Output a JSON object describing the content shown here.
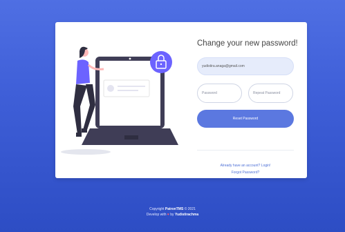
{
  "form": {
    "title": "Change your new password!",
    "email_value": "yudistira.anaga@gmail.com",
    "password_placeholder": "Password",
    "repeat_password_placeholder": "Repeat Password",
    "reset_button_label": "Reset Password",
    "login_link": "Already have an account? Login!",
    "forgot_link": "Forgot Password?"
  },
  "footer": {
    "copyright_prefix": "Copyright",
    "brand": "PatronTMS",
    "copyright_suffix": "© 2021",
    "develop_prefix": "Develop with",
    "heart": "♥",
    "develop_by": "by",
    "author": "Yudistirachma"
  },
  "colors": {
    "accent": "#5b78e0",
    "background": "#3f5fd8",
    "illustration_purple": "#6c63ff"
  },
  "icons": [
    "padlock-icon",
    "person-illustration",
    "laptop-illustration"
  ]
}
